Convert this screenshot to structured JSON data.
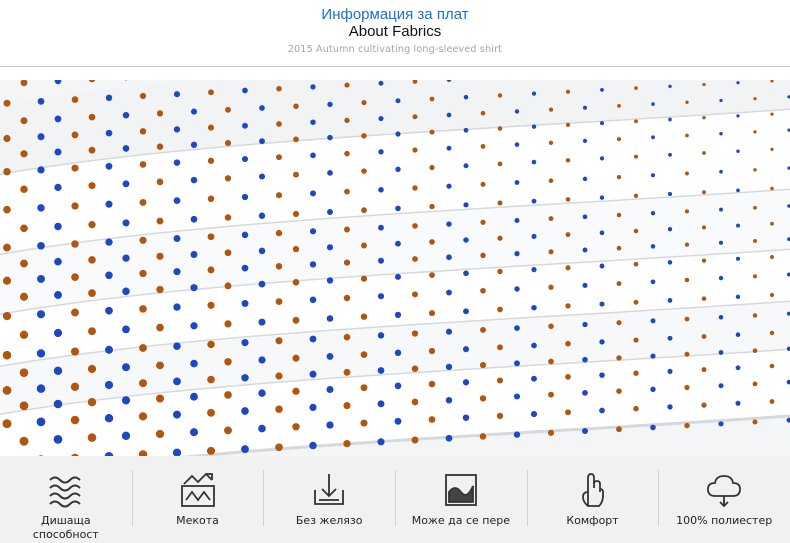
{
  "header": {
    "title_bg": "Информация за плат",
    "title_en": "About Fabrics",
    "subtitle": "2015 Autumn cultivating long-sleeved shirt"
  },
  "photo": {
    "alt": "",
    "colors": {
      "background": "#ffffff",
      "dot_blue": "#1d48c2",
      "dot_brown": "#b0560f"
    }
  },
  "features": [
    {
      "icon": "waves-icon",
      "label": "Дишаща способност"
    },
    {
      "icon": "softness-icon",
      "label": "Мекота"
    },
    {
      "icon": "no-iron-icon",
      "label": "Без желязо"
    },
    {
      "icon": "washable-icon",
      "label": "Може да се пере"
    },
    {
      "icon": "hand-comfort-icon",
      "label": "Комфорт"
    },
    {
      "icon": "cloud-polyester-icon",
      "label": "100% полиестер"
    }
  ]
}
